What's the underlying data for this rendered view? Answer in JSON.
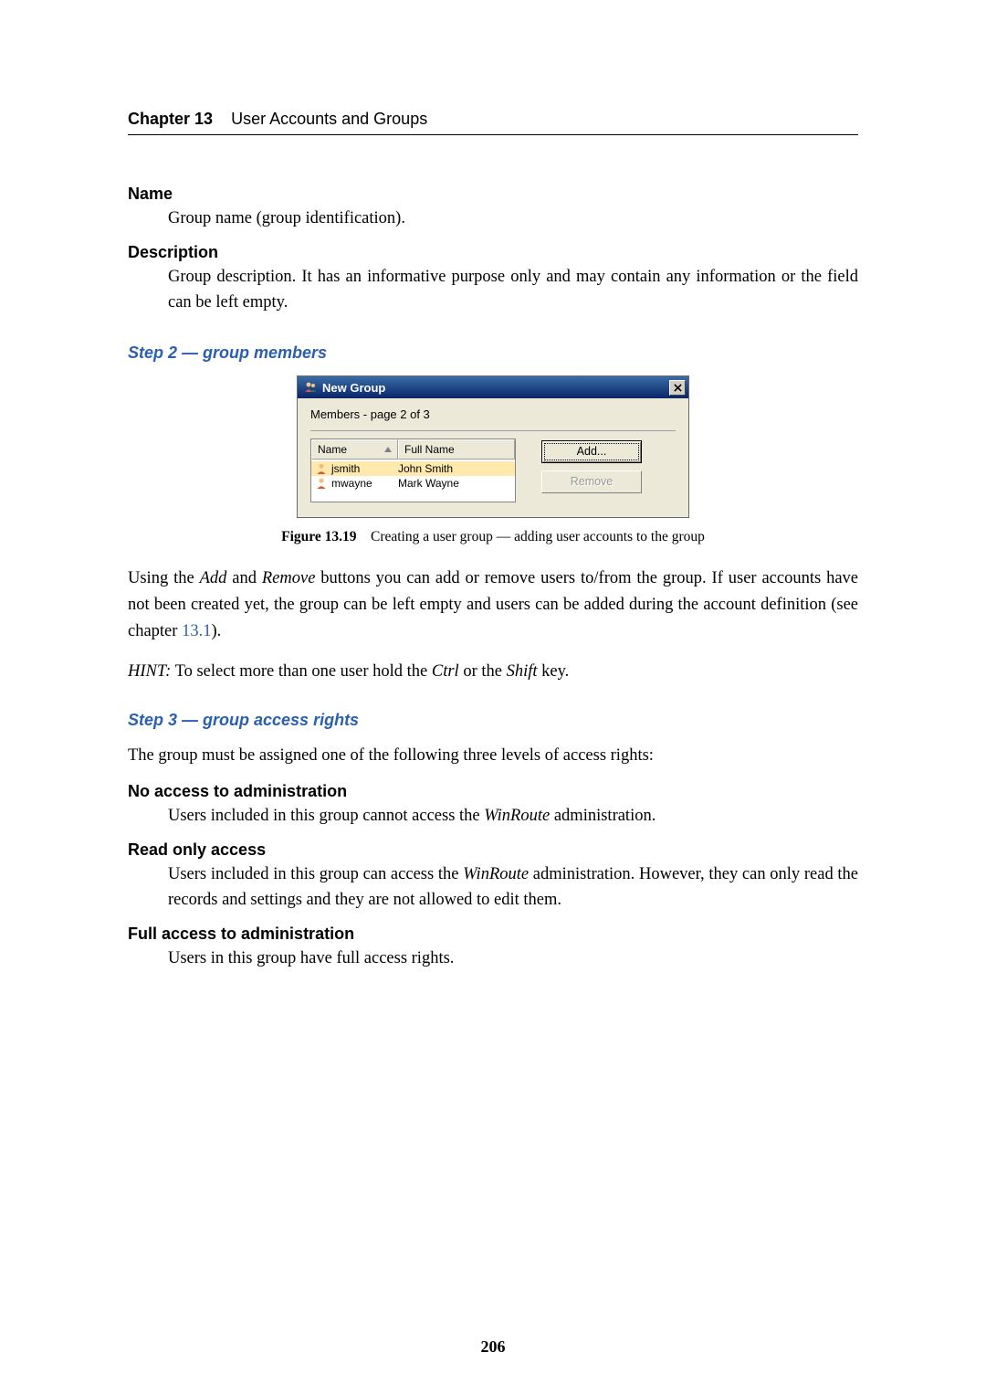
{
  "chapter": {
    "label": "Chapter 13",
    "title": "User Accounts and Groups"
  },
  "defs": {
    "name_term": "Name",
    "name_def": "Group name (group identification).",
    "desc_term": "Description",
    "desc_def": "Group description. It has an informative purpose only and may contain any information or the field can be left empty."
  },
  "step2": {
    "heading": "Step 2 — group members",
    "dialog": {
      "title": "New Group",
      "subtitle": "Members - page 2 of 3",
      "col_name": "Name",
      "col_full": "Full Name",
      "rows": [
        {
          "user": "jsmith",
          "full": "John Smith"
        },
        {
          "user": "mwayne",
          "full": "Mark Wayne"
        }
      ],
      "add_label": "Add...",
      "remove_label": "Remove"
    },
    "caption_bold": "Figure 13.19",
    "caption_rest": "Creating a user group — adding user accounts to the group",
    "p1_a": "Using the ",
    "p1_add": "Add",
    "p1_b": " and ",
    "p1_remove": "Remove",
    "p1_c": " buttons you can add or remove users to/from the group. If user accounts have not been created yet, the group can be left empty and users can be added during the account definition (see chapter ",
    "p1_link": "13.1",
    "p1_d": ").",
    "p2_a": "HINT:",
    "p2_b": " To select more than one user hold the ",
    "p2_ctrl": "Ctrl",
    "p2_c": " or the ",
    "p2_shift": "Shift",
    "p2_d": " key."
  },
  "step3": {
    "heading": "Step 3 — group access rights",
    "intro": "The group must be assigned one of the following three levels of access rights:",
    "noaccess_term": "No access to administration",
    "noaccess_def_a": "Users included in this group cannot access the ",
    "noaccess_def_em": "WinRoute",
    "noaccess_def_b": " administration.",
    "readonly_term": "Read only access",
    "readonly_def_a": "Users included in this group can access the ",
    "readonly_def_em": "WinRoute",
    "readonly_def_b": " administration. However, they can only read the records and settings and they are not allowed to edit them.",
    "full_term": "Full access to administration",
    "full_def": "Users in this group have full access rights."
  },
  "page_number": "206"
}
